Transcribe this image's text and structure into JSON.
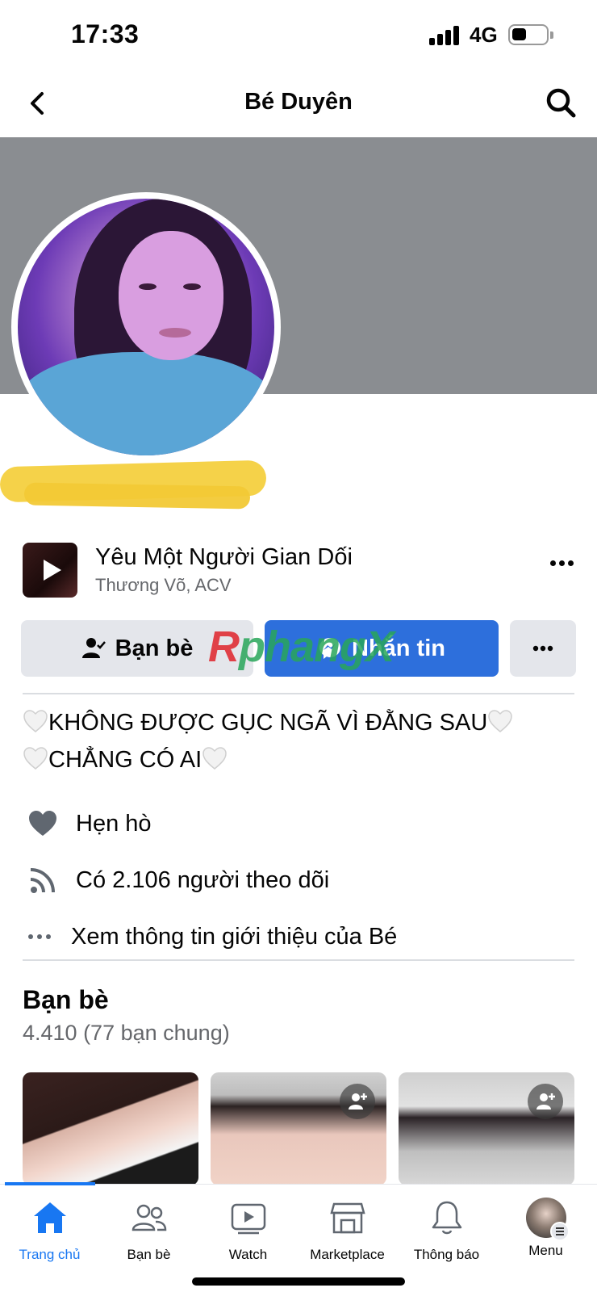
{
  "status_bar": {
    "time": "17:33",
    "network": "4G"
  },
  "header": {
    "title": "Bé Duyên"
  },
  "profile_music": {
    "title": "Yêu Một Người Gian Dối",
    "artist": "Thương Võ, ACV"
  },
  "actions": {
    "friends_label": "Bạn bè",
    "message_label": "Nhắn tin"
  },
  "watermark": {
    "part1": "R",
    "part2": "phangX"
  },
  "bio": {
    "line1": "KHÔNG ĐƯỢC GỤC NGÃ VÌ ĐẰNG SAU",
    "line2": "CHẲNG CÓ AI"
  },
  "details": {
    "dating": "Hẹn hò",
    "followers": "Có 2.106 người theo dõi",
    "see_about": "Xem thông tin giới thiệu của Bé"
  },
  "friends_section": {
    "title": "Bạn bè",
    "count": "4.410 (77 bạn chung)"
  },
  "tabbar": [
    {
      "label": "Trang chủ",
      "icon": "home-icon",
      "active": true
    },
    {
      "label": "Bạn bè",
      "icon": "friends-icon",
      "active": false
    },
    {
      "label": "Watch",
      "icon": "watch-icon",
      "active": false
    },
    {
      "label": "Marketplace",
      "icon": "marketplace-icon",
      "active": false
    },
    {
      "label": "Thông báo",
      "icon": "bell-icon",
      "active": false
    },
    {
      "label": "Menu",
      "icon": "menu-avatar",
      "active": false
    }
  ],
  "colors": {
    "accent": "#1877f2",
    "message_button": "#2d6fdc",
    "cover": "#8a8d91",
    "secondary_text": "#65676b"
  }
}
